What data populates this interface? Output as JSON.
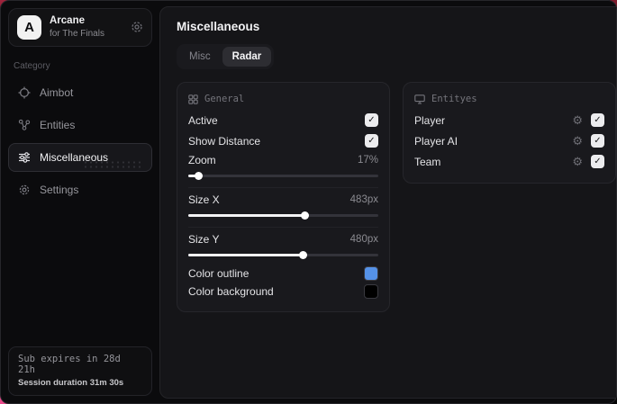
{
  "sidebar": {
    "logo": {
      "initial": "A",
      "title": "Arcane",
      "subtitle": "for The Finals"
    },
    "category_label": "Category",
    "items": [
      {
        "label": "Aimbot",
        "icon": "crosshair-icon",
        "selected": false
      },
      {
        "label": "Entities",
        "icon": "entities-icon",
        "selected": false
      },
      {
        "label": "Miscellaneous",
        "icon": "sliders-icon",
        "selected": true
      },
      {
        "label": "Settings",
        "icon": "gear-icon",
        "selected": false
      }
    ],
    "footer": {
      "line1": "Sub expires in 28d 21h",
      "line2": "Session duration 31m 30s"
    }
  },
  "main": {
    "title": "Miscellaneous",
    "tabs": [
      {
        "label": "Misc",
        "active": false
      },
      {
        "label": "Radar",
        "active": true
      }
    ],
    "general": {
      "title": "General",
      "icon": "grid-icon",
      "toggles": [
        {
          "label": "Active",
          "checked": true,
          "check": "✓"
        },
        {
          "label": "Show Distance",
          "checked": true,
          "check": "✓"
        }
      ],
      "sliders": [
        {
          "label": "Zoom",
          "value": "17%",
          "percent": 5
        },
        {
          "label": "Size X",
          "value": "483px",
          "percent": 61
        },
        {
          "label": "Size Y",
          "value": "480px",
          "percent": 60
        }
      ],
      "colors": [
        {
          "label": "Color outline",
          "color": "#5592e8"
        },
        {
          "label": "Color background",
          "color": "#000000"
        }
      ]
    },
    "entities": {
      "title": "Entityes",
      "icon": "monitor-icon",
      "gear": "⚙",
      "rows": [
        {
          "label": "Player",
          "checked": true,
          "check": "✓"
        },
        {
          "label": "Player AI",
          "checked": true,
          "check": "✓"
        },
        {
          "label": "Team",
          "checked": true,
          "check": "✓"
        }
      ]
    }
  },
  "colors": {
    "accent_red": "#a1243c",
    "accent_pink": "#e84a8a",
    "outline_blue": "#5592e8"
  }
}
